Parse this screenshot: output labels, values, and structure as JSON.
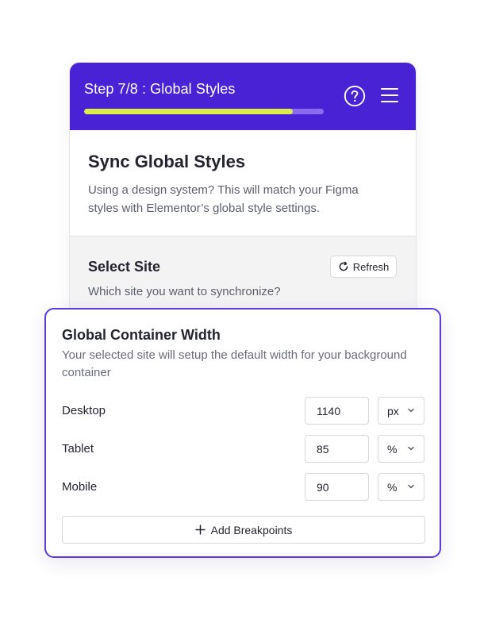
{
  "header": {
    "step_title": "Step 7/8 : Global Styles",
    "progress_fraction": 0.87,
    "help_icon": "question-circle-icon",
    "menu_icon": "hamburger-menu-icon",
    "bg_color": "#4a22d6",
    "progress_color": "#dcec48"
  },
  "intro": {
    "title": "Sync Global Styles",
    "description": "Using a design system? This will match your Figma styles with Elementor’s global style settings."
  },
  "select_site": {
    "title": "Select Site",
    "description": "Which site you want to synchronize?",
    "refresh_label": "Refresh",
    "refresh_icon": "refresh-icon"
  },
  "container_width": {
    "title": "Global Container Width",
    "description": "Your selected site will setup the default width for your background container",
    "rows": [
      {
        "label": "Desktop",
        "value": "1140",
        "unit": "px"
      },
      {
        "label": "Tablet",
        "value": "85",
        "unit": "%"
      },
      {
        "label": "Mobile",
        "value": "90",
        "unit": "%"
      }
    ],
    "add_breakpoints_label": "Add Breakpoints",
    "accent_color": "#5b3ae0"
  }
}
